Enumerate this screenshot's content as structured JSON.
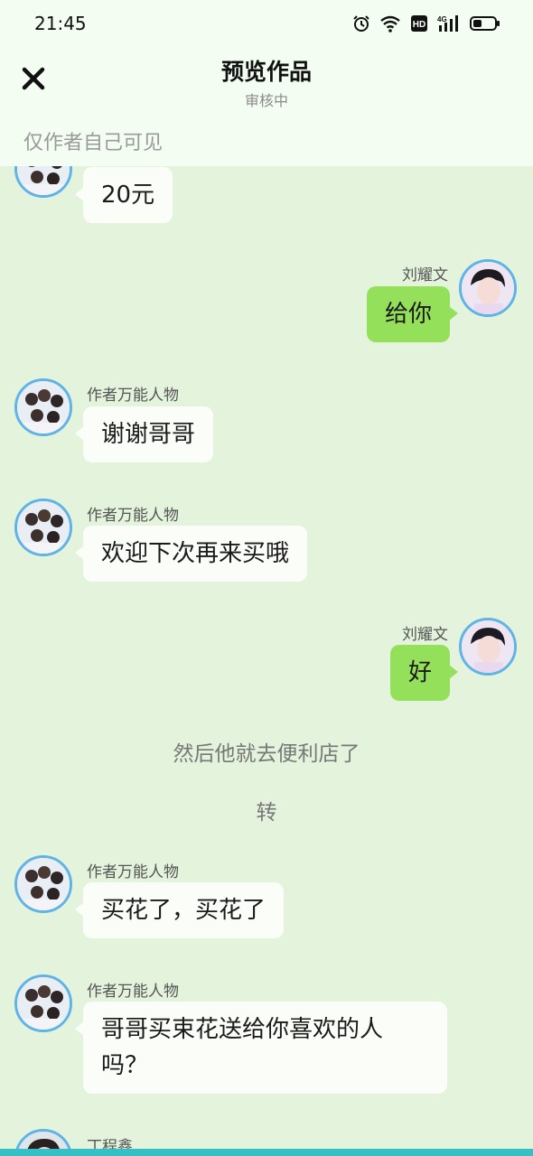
{
  "status_bar": {
    "time": "21:45",
    "icons": [
      "alarm-icon",
      "wifi-icon",
      "hd-icon",
      "signal-4g-icon",
      "battery-icon"
    ],
    "hd_label": "HD",
    "network_label": "4G"
  },
  "header": {
    "close_icon": "close-icon",
    "title": "预览作品",
    "subtitle": "审核中",
    "visibility_note": "仅作者自己可见"
  },
  "colors": {
    "background": "#e4f3dc",
    "top_panel": "#f3fdf2",
    "left_bubble": "#fbfdf9",
    "right_bubble": "#95e05a",
    "avatar_border": "#5fb3e6",
    "bottom_strip": "#36c0c6"
  },
  "messages": [
    {
      "type": "left",
      "sender": "",
      "text": "20元"
    },
    {
      "type": "right",
      "sender": "刘耀文",
      "text": "给你"
    },
    {
      "type": "left",
      "sender": "作者万能人物",
      "text": "谢谢哥哥"
    },
    {
      "type": "left",
      "sender": "作者万能人物",
      "text": "欢迎下次再来买哦"
    },
    {
      "type": "right",
      "sender": "刘耀文",
      "text": "好"
    },
    {
      "type": "narration",
      "text": "然后他就去便利店了"
    },
    {
      "type": "narration",
      "text": "转"
    },
    {
      "type": "left",
      "sender": "作者万能人物",
      "text": "买花了，买花了"
    },
    {
      "type": "left",
      "sender": "作者万能人物",
      "text_lines": [
        "哥哥买束花送给你喜欢的人",
        "吗？"
      ]
    },
    {
      "type": "left",
      "sender": "丁程鑫",
      "text": ""
    }
  ]
}
